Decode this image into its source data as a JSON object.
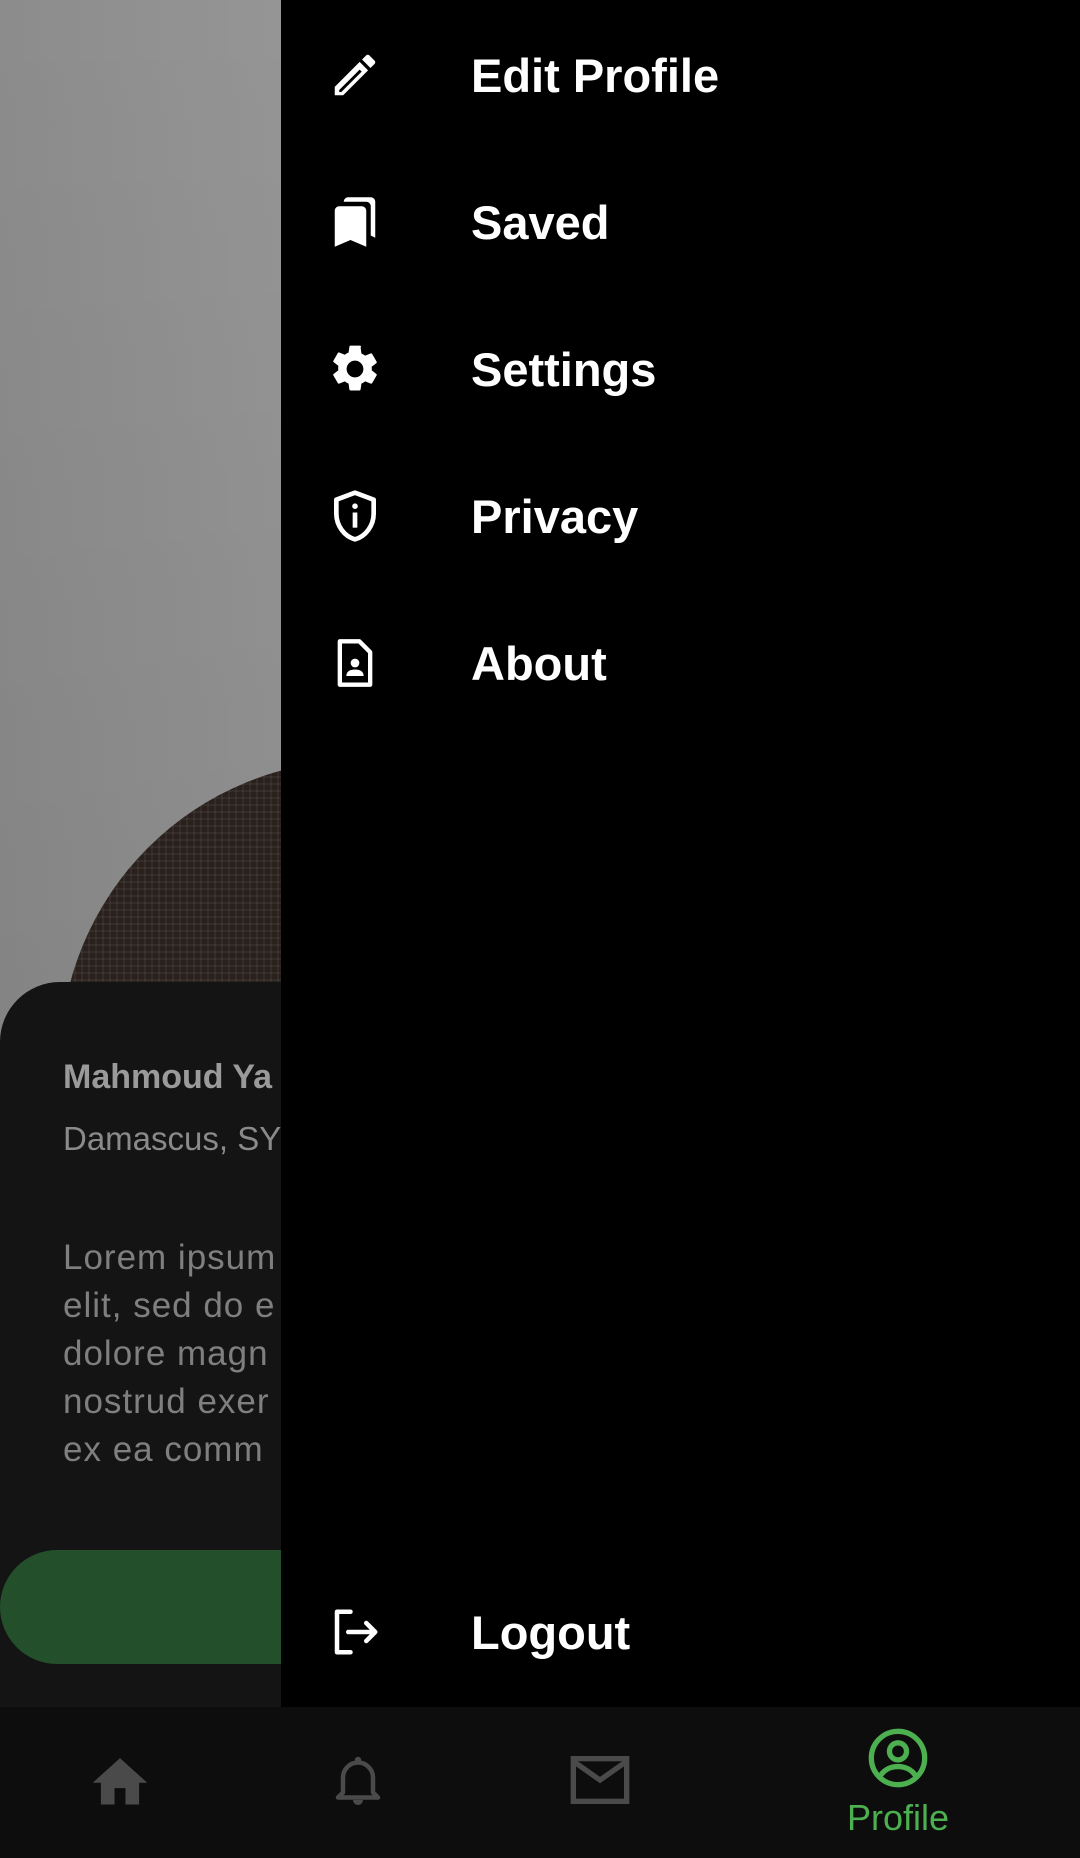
{
  "profile": {
    "name": "Mahmoud Ya",
    "location": "Damascus, SY",
    "bio_lines": [
      "Lorem ipsum",
      "elit, sed do e",
      "dolore magn",
      "nostrud exer",
      "ex ea comm"
    ]
  },
  "drawer": {
    "items": [
      {
        "label": "Edit Profile",
        "icon": "pencil-icon"
      },
      {
        "label": "Saved",
        "icon": "bookmarks-icon"
      },
      {
        "label": "Settings",
        "icon": "gear-icon"
      },
      {
        "label": "Privacy",
        "icon": "shield-info-icon"
      },
      {
        "label": "About",
        "icon": "contact-page-icon"
      }
    ],
    "logout": {
      "label": "Logout",
      "icon": "logout-icon"
    }
  },
  "bottom_nav": {
    "items": [
      {
        "icon": "home-icon",
        "active": false
      },
      {
        "icon": "bell-icon",
        "active": false
      },
      {
        "icon": "mail-icon",
        "active": false
      },
      {
        "icon": "profile-icon",
        "label": "Profile",
        "active": true
      }
    ]
  },
  "colors": {
    "accent": "#4caf50",
    "inactive_icon": "#4a4a4a",
    "drawer_bg": "#000000",
    "follow_button": "#23502a"
  }
}
